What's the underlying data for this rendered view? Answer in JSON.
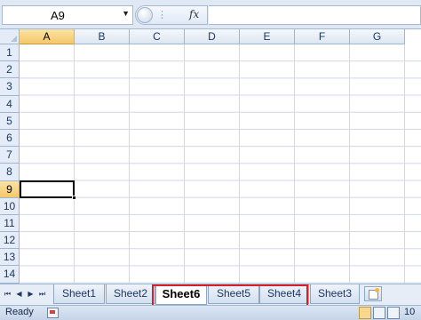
{
  "formula_bar": {
    "name_box_value": "A9",
    "fx_label": "fx",
    "formula_value": ""
  },
  "columns": [
    "A",
    "B",
    "C",
    "D",
    "E",
    "F",
    "G"
  ],
  "rows": [
    "1",
    "2",
    "3",
    "4",
    "5",
    "6",
    "7",
    "8",
    "9",
    "10",
    "11",
    "12",
    "13",
    "14"
  ],
  "active_cell": {
    "column": "A",
    "row": "9"
  },
  "sheet_tabs": [
    "Sheet1",
    "Sheet2",
    "Sheet6",
    "Sheet5",
    "Sheet4",
    "Sheet3"
  ],
  "active_sheet": "Sheet6",
  "status_bar": {
    "status": "Ready",
    "zoom_partial": "10"
  },
  "colors": {
    "highlight_box": "#d81e2a",
    "active_header": "#f5c76a"
  }
}
